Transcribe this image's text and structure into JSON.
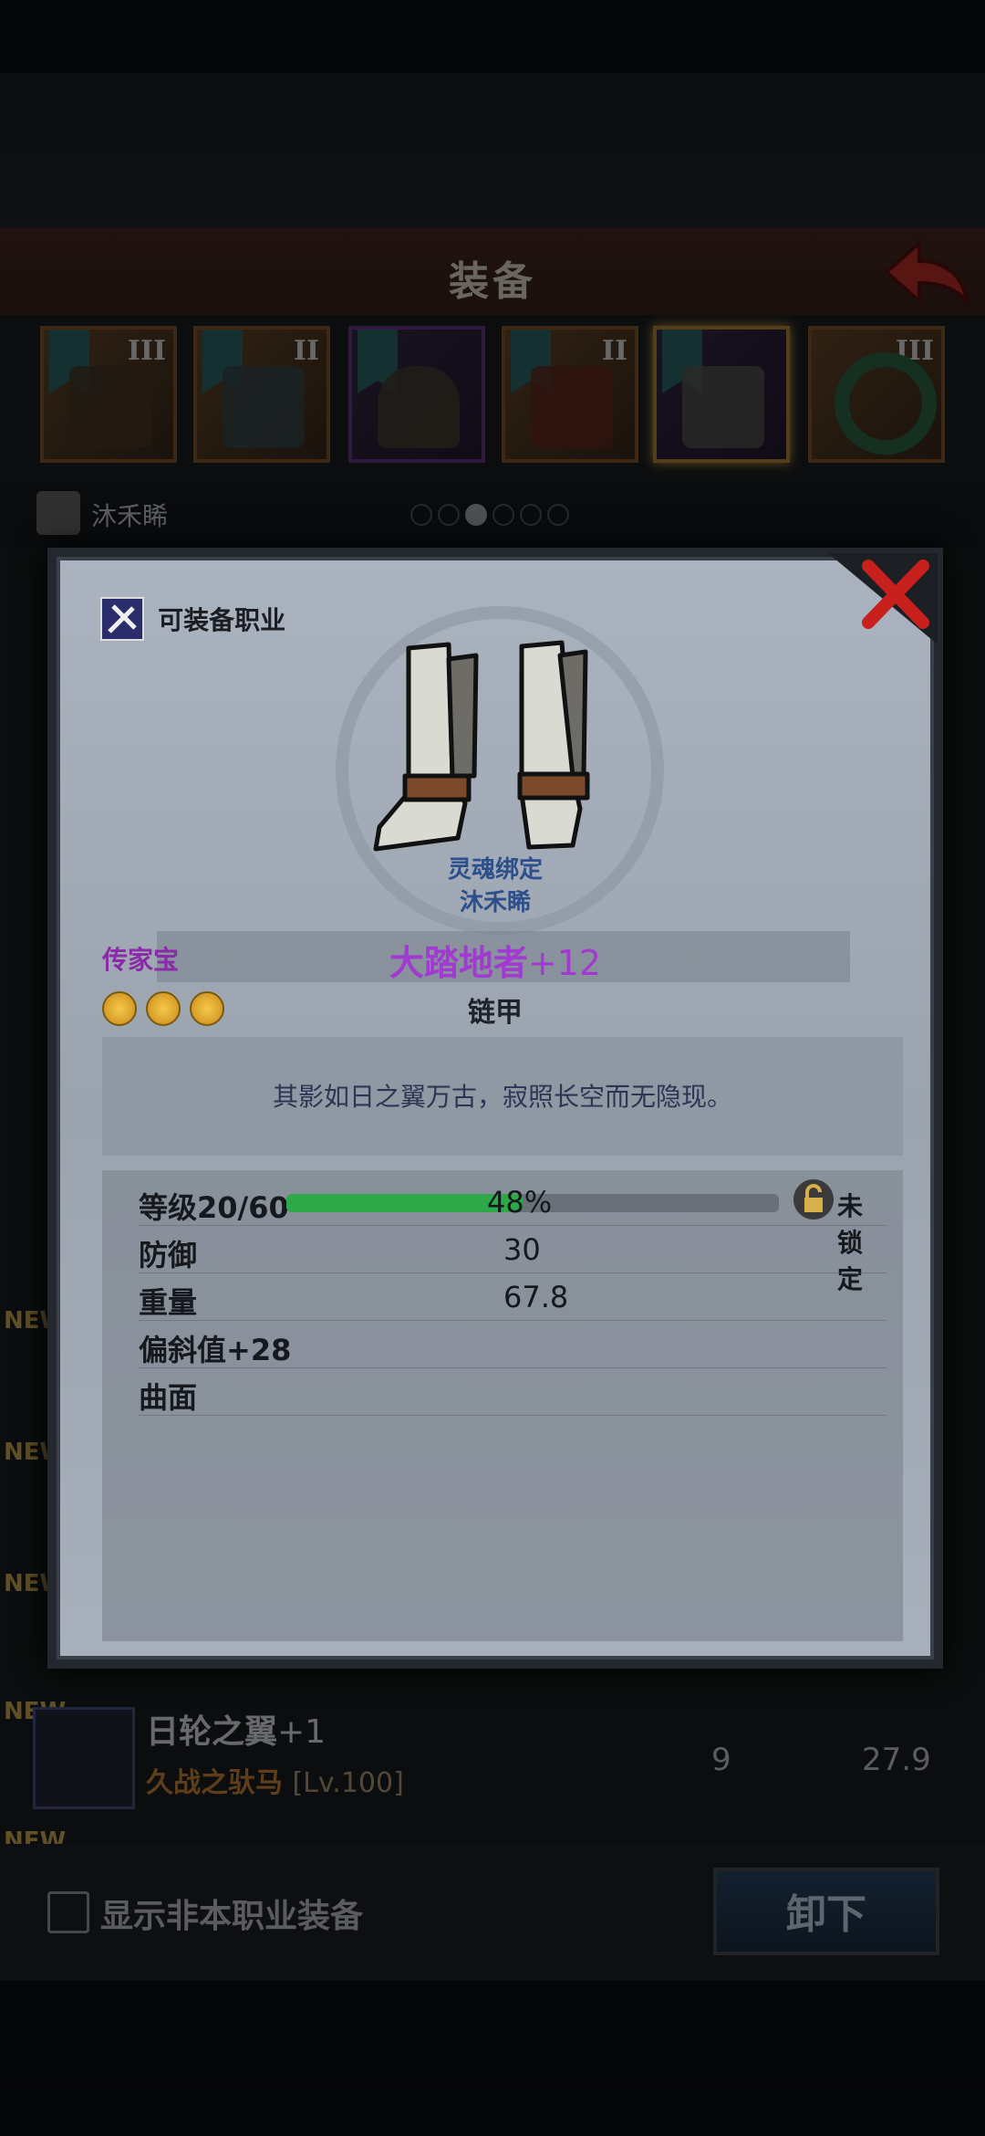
{
  "header": {
    "title": "装备"
  },
  "slots": [
    {
      "tier": "III",
      "kind": "weapon"
    },
    {
      "tier": "II",
      "kind": "shield"
    },
    {
      "tier": "",
      "kind": "helmet"
    },
    {
      "tier": "II",
      "kind": "armor"
    },
    {
      "tier": "",
      "kind": "boots",
      "selected": true
    },
    {
      "tier": "III",
      "kind": "ring"
    }
  ],
  "character": {
    "name": "沐禾睎"
  },
  "pagination": {
    "total": 6,
    "active": 2
  },
  "list": {
    "new_label": "NEW",
    "item": {
      "name": "日轮之翼",
      "plus": "+1",
      "owner": "久战之驮马",
      "level": "[Lv.100]",
      "val1": "9",
      "val2": "27.9"
    }
  },
  "bottom": {
    "checkbox_label": "显示非本职业装备",
    "unequip_label": "卸下"
  },
  "popup": {
    "classes_label": "可装备职业",
    "soulbound": "灵魂绑定",
    "soulbound_owner": "沐禾睎",
    "rarity": "传家宝",
    "name": "大踏地者",
    "plus": "+12",
    "type": "链甲",
    "stars": 3,
    "description": "其影如日之翼万古，寂照长空而无隐现。",
    "level_label": "等级20/60",
    "progress_text": "48%",
    "progress": 0.48,
    "lock_label": "未锁定",
    "stats": [
      {
        "label": "防御",
        "value": "30"
      },
      {
        "label": "重量",
        "value": "67.8"
      },
      {
        "label": "偏斜值+28",
        "value": ""
      },
      {
        "label": "曲面",
        "value": ""
      }
    ]
  },
  "colors": {
    "rarity": "#8a2aa8",
    "name": "#a13ad0",
    "progress": "#2fa84a",
    "owner": "#d08a3a"
  }
}
